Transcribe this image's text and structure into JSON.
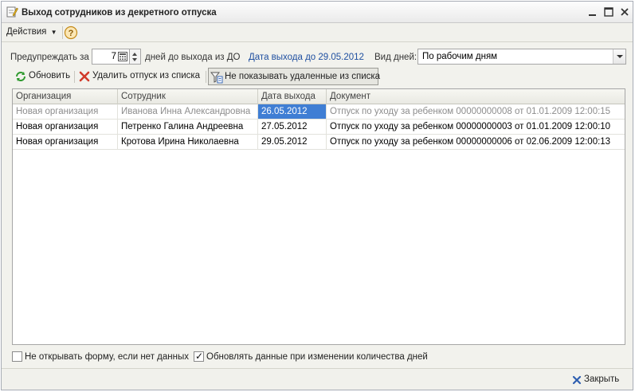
{
  "window": {
    "title": "Выход сотрудников из декретного отпуска",
    "title_icon": "document-edit-icon",
    "controls": [
      "minimize-icon",
      "maximize-icon",
      "close-icon"
    ]
  },
  "menu": {
    "actions_label": "Действия",
    "help_icon": "help-icon"
  },
  "filters": {
    "warn_label": "Предупреждать за",
    "days_value": "7",
    "days_suffix": "дней до выхода из ДО",
    "date_link": "Дата выхода до 29.05.2012",
    "day_type_label": "Вид дней:",
    "day_type_value": "По рабочим дням"
  },
  "toolbar": {
    "refresh_label": "Обновить",
    "delete_label": "Удалить отпуск из списка",
    "hide_deleted_label": "Не показывать удаленные из списка"
  },
  "table": {
    "columns": [
      "Организация",
      "Сотрудник",
      "Дата выхода",
      "Документ"
    ],
    "rows": [
      {
        "org": "Новая организация",
        "employee": "Иванова Инна Александровна",
        "date": "26.05.2012",
        "doc": "Отпуск по уходу за ребенком 00000000008 от 01.01.2009 12:00:15",
        "muted": true,
        "selected_date": true
      },
      {
        "org": "Новая организация",
        "employee": "Петренко Галина Андреевна",
        "date": "27.05.2012",
        "doc": "Отпуск по уходу за ребенком 00000000003 от 01.01.2009 12:00:10",
        "muted": false,
        "selected_date": false
      },
      {
        "org": "Новая организация",
        "employee": "Кротова Ирина Николаевна",
        "date": "29.05.2012",
        "doc": "Отпуск по уходу за ребенком 00000000006 от 02.06.2009 12:00:13",
        "muted": false,
        "selected_date": false
      }
    ]
  },
  "options": {
    "no_open_label": "Не открывать форму, если нет данных",
    "no_open_checked": false,
    "refresh_on_change_label": "Обновлять данные при изменении количества дней",
    "refresh_on_change_checked": true
  },
  "footer": {
    "close_label": "Закрыть"
  },
  "colors": {
    "selection": "#3f7ed4",
    "link": "#1f4fa0",
    "window_bg": "#f2f2ed"
  }
}
